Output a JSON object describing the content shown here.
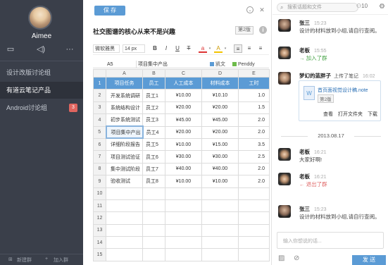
{
  "sidebar": {
    "user_name": "Aimee",
    "icons": [
      "message-icon",
      "speaker-icon",
      "more-icon"
    ],
    "groups": [
      {
        "label": "设计改版讨论组",
        "active": false,
        "badge": ""
      },
      {
        "label": "有道云笔记产品",
        "active": true,
        "badge": ""
      },
      {
        "label": "Android讨论组",
        "active": false,
        "badge": "3"
      }
    ],
    "bottom_new_group": "新建群",
    "bottom_join_group": "加入群"
  },
  "editor": {
    "save_label": "保 存",
    "title": "社交图谱的核心从来不是兴趣",
    "version": "第2版",
    "toolbar": {
      "font_family": "微软雅黑",
      "font_size": "14 px",
      "bold": "B",
      "italic": "I",
      "underline": "U",
      "strike": "T",
      "font_color": "a",
      "fill_color": "A"
    },
    "formula": {
      "cell_ref": "A5",
      "cell_value": "项目集中产出",
      "presence": [
        {
          "name": "凯文",
          "color": "#5b9bd5"
        },
        {
          "name": "Penddy",
          "color": "#6dbb4a"
        }
      ]
    },
    "sheet": {
      "columns": [
        "A",
        "B",
        "C",
        "D",
        "E"
      ],
      "rows": [
        [
          "项目任务",
          "员工",
          "人工成本",
          "材料成本",
          "工时"
        ],
        [
          "开发系统调研",
          "员工1",
          "¥10.00",
          "¥10.10",
          "1.0"
        ],
        [
          "系统结构设计",
          "员工2",
          "¥20.00",
          "¥20.00",
          "1.5"
        ],
        [
          "初步系统测试",
          "员工3",
          "¥45.00",
          "¥45.00",
          "2.0"
        ],
        [
          "项目集中产出",
          "员工4",
          "¥20.00",
          "¥20.00",
          "2.0"
        ],
        [
          "详细阶段报告",
          "员工5",
          "¥10.00",
          "¥15.00",
          "3.5"
        ],
        [
          "项目测试验证",
          "员工6",
          "¥30.00",
          "¥30.00",
          "2.5"
        ],
        [
          "集中测试阶段",
          "员工7",
          "¥40.00",
          "¥40.00",
          "2.0"
        ],
        [
          "验收测试",
          "员工8",
          "¥10.00",
          "¥10.00",
          "2.0"
        ],
        [
          "",
          "",
          "",
          "",
          ""
        ],
        [
          "",
          "",
          "",
          "",
          ""
        ],
        [
          "",
          "",
          "",
          "",
          ""
        ],
        [
          "",
          "",
          "",
          "",
          ""
        ],
        [
          "",
          "",
          "",
          "",
          ""
        ],
        [
          "",
          "",
          "",
          "",
          ""
        ]
      ]
    }
  },
  "chat": {
    "search_placeholder": "搜索话题和文件",
    "member_count": "10",
    "messages": [
      {
        "name": "张三",
        "time": "15:23",
        "text": "设计的材料放到小组,请自行查阅。",
        "system": false
      },
      {
        "name": "老板",
        "time": "15:55",
        "text": "→ 加入了群",
        "system": true
      },
      {
        "name": "梦幻的蓝胖子",
        "time": "16:02",
        "text": "上传了笔记",
        "system": false
      },
      {
        "name": "老板",
        "time": "16:21",
        "text": "大家好啊!",
        "system": false
      },
      {
        "name": "老板",
        "time": "16:21",
        "text": "← 退出了群",
        "system": true
      },
      {
        "name": "张三",
        "time": "15:23",
        "text": "设计的材料放到小组,请自行查阅。",
        "system": false
      }
    ],
    "file": {
      "name": "首页面视觉设计稿.note",
      "version": "第2版",
      "actions": [
        "查看",
        "打开文件夹",
        "下载"
      ]
    },
    "date_separator": "2013.08.17",
    "input_placeholder": "输入你想说的话...",
    "send_label": "发 送"
  }
}
